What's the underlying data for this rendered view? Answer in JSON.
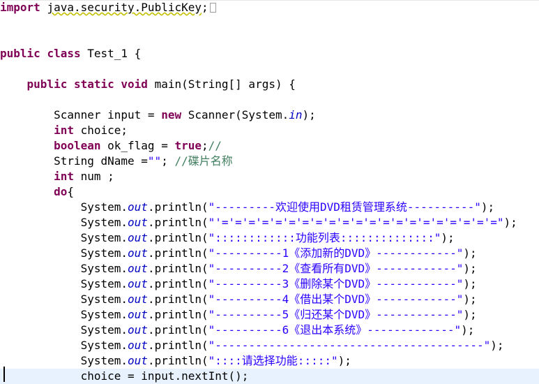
{
  "editor": {
    "lines": [
      {
        "indent": "",
        "tokens": [
          {
            "t": "kw",
            "v": "import"
          },
          {
            "t": "plain",
            "v": " "
          },
          {
            "t": "import",
            "v": "java.security.PublicKey"
          },
          {
            "t": "plain",
            "v": ";"
          },
          {
            "t": "box",
            "v": ""
          }
        ]
      },
      {
        "indent": "",
        "tokens": []
      },
      {
        "indent": "",
        "tokens": []
      },
      {
        "indent": "",
        "tokens": [
          {
            "t": "kw",
            "v": "public"
          },
          {
            "t": "plain",
            "v": " "
          },
          {
            "t": "kw",
            "v": "class"
          },
          {
            "t": "plain",
            "v": " Test_1 {"
          }
        ]
      },
      {
        "indent": "",
        "tokens": []
      },
      {
        "indent": "    ",
        "tokens": [
          {
            "t": "kw",
            "v": "public"
          },
          {
            "t": "plain",
            "v": " "
          },
          {
            "t": "kw",
            "v": "static"
          },
          {
            "t": "plain",
            "v": " "
          },
          {
            "t": "kw",
            "v": "void"
          },
          {
            "t": "plain",
            "v": " main(String[] args) {"
          }
        ]
      },
      {
        "indent": "",
        "tokens": []
      },
      {
        "indent": "        ",
        "tokens": [
          {
            "t": "plain",
            "v": "Scanner input = "
          },
          {
            "t": "kw",
            "v": "new"
          },
          {
            "t": "plain",
            "v": " Scanner(System."
          },
          {
            "t": "field",
            "v": "in"
          },
          {
            "t": "plain",
            "v": ");"
          }
        ]
      },
      {
        "indent": "        ",
        "tokens": [
          {
            "t": "kw",
            "v": "int"
          },
          {
            "t": "plain",
            "v": " choice;"
          }
        ]
      },
      {
        "indent": "        ",
        "tokens": [
          {
            "t": "kw",
            "v": "boolean"
          },
          {
            "t": "plain",
            "v": " ok_flag = "
          },
          {
            "t": "kw",
            "v": "true"
          },
          {
            "t": "plain",
            "v": ";"
          },
          {
            "t": "cm",
            "v": "//"
          }
        ]
      },
      {
        "indent": "        ",
        "tokens": [
          {
            "t": "plain",
            "v": "String dName ="
          },
          {
            "t": "str",
            "v": "\"\""
          },
          {
            "t": "plain",
            "v": "; "
          },
          {
            "t": "cm",
            "v": "//碟片名称"
          }
        ]
      },
      {
        "indent": "        ",
        "tokens": [
          {
            "t": "kw",
            "v": "int"
          },
          {
            "t": "plain",
            "v": " num ;"
          }
        ]
      },
      {
        "indent": "        ",
        "tokens": [
          {
            "t": "kw",
            "v": "do"
          },
          {
            "t": "plain",
            "v": "{"
          }
        ]
      },
      {
        "indent": "            ",
        "tokens": [
          {
            "t": "plain",
            "v": "System."
          },
          {
            "t": "field",
            "v": "out"
          },
          {
            "t": "plain",
            "v": ".println("
          },
          {
            "t": "str",
            "v": "\"---------欢迎使用DVD租赁管理系统----------\""
          },
          {
            "t": "plain",
            "v": ");"
          }
        ]
      },
      {
        "indent": "            ",
        "tokens": [
          {
            "t": "plain",
            "v": "System."
          },
          {
            "t": "field",
            "v": "out"
          },
          {
            "t": "plain",
            "v": ".println("
          },
          {
            "t": "str",
            "v": "\"'='='='='='='='='='='='='='='='='='='='='=\""
          },
          {
            "t": "plain",
            "v": ");"
          }
        ]
      },
      {
        "indent": "            ",
        "tokens": [
          {
            "t": "plain",
            "v": "System."
          },
          {
            "t": "field",
            "v": "out"
          },
          {
            "t": "plain",
            "v": ".println("
          },
          {
            "t": "str",
            "v": "\"::::::::::::功能列表::::::::::::::\""
          },
          {
            "t": "plain",
            "v": ");"
          }
        ]
      },
      {
        "indent": "            ",
        "tokens": [
          {
            "t": "plain",
            "v": "System."
          },
          {
            "t": "field",
            "v": "out"
          },
          {
            "t": "plain",
            "v": ".println("
          },
          {
            "t": "str",
            "v": "\"----------1《添加新的DVD》------------\""
          },
          {
            "t": "plain",
            "v": ");"
          }
        ]
      },
      {
        "indent": "            ",
        "tokens": [
          {
            "t": "plain",
            "v": "System."
          },
          {
            "t": "field",
            "v": "out"
          },
          {
            "t": "plain",
            "v": ".println("
          },
          {
            "t": "str",
            "v": "\"----------2《查看所有DVD》------------\""
          },
          {
            "t": "plain",
            "v": ");"
          }
        ]
      },
      {
        "indent": "            ",
        "tokens": [
          {
            "t": "plain",
            "v": "System."
          },
          {
            "t": "field",
            "v": "out"
          },
          {
            "t": "plain",
            "v": ".println("
          },
          {
            "t": "str",
            "v": "\"----------3《删除某个DVD》------------\""
          },
          {
            "t": "plain",
            "v": ");"
          }
        ]
      },
      {
        "indent": "            ",
        "tokens": [
          {
            "t": "plain",
            "v": "System."
          },
          {
            "t": "field",
            "v": "out"
          },
          {
            "t": "plain",
            "v": ".println("
          },
          {
            "t": "str",
            "v": "\"----------4《借出某个DVD》------------\""
          },
          {
            "t": "plain",
            "v": ");"
          }
        ]
      },
      {
        "indent": "            ",
        "tokens": [
          {
            "t": "plain",
            "v": "System."
          },
          {
            "t": "field",
            "v": "out"
          },
          {
            "t": "plain",
            "v": ".println("
          },
          {
            "t": "str",
            "v": "\"----------5《归还某个DVD》------------\""
          },
          {
            "t": "plain",
            "v": ");"
          }
        ]
      },
      {
        "indent": "            ",
        "tokens": [
          {
            "t": "plain",
            "v": "System."
          },
          {
            "t": "field",
            "v": "out"
          },
          {
            "t": "plain",
            "v": ".println("
          },
          {
            "t": "str",
            "v": "\"----------6《退出本系统》-------------\""
          },
          {
            "t": "plain",
            "v": ");"
          }
        ]
      },
      {
        "indent": "            ",
        "tokens": [
          {
            "t": "plain",
            "v": "System."
          },
          {
            "t": "field",
            "v": "out"
          },
          {
            "t": "plain",
            "v": ".println("
          },
          {
            "t": "str",
            "v": "\"----------------------------------------\""
          },
          {
            "t": "plain",
            "v": ");"
          }
        ]
      },
      {
        "indent": "            ",
        "tokens": [
          {
            "t": "plain",
            "v": "System."
          },
          {
            "t": "field",
            "v": "out"
          },
          {
            "t": "plain",
            "v": ".println("
          },
          {
            "t": "str",
            "v": "\"::::请选择功能:::::\""
          },
          {
            "t": "plain",
            "v": ");"
          }
        ]
      },
      {
        "indent": "            ",
        "current": true,
        "tokens": [
          {
            "t": "plain",
            "v": "choice = input.nextInt();"
          }
        ]
      }
    ]
  }
}
